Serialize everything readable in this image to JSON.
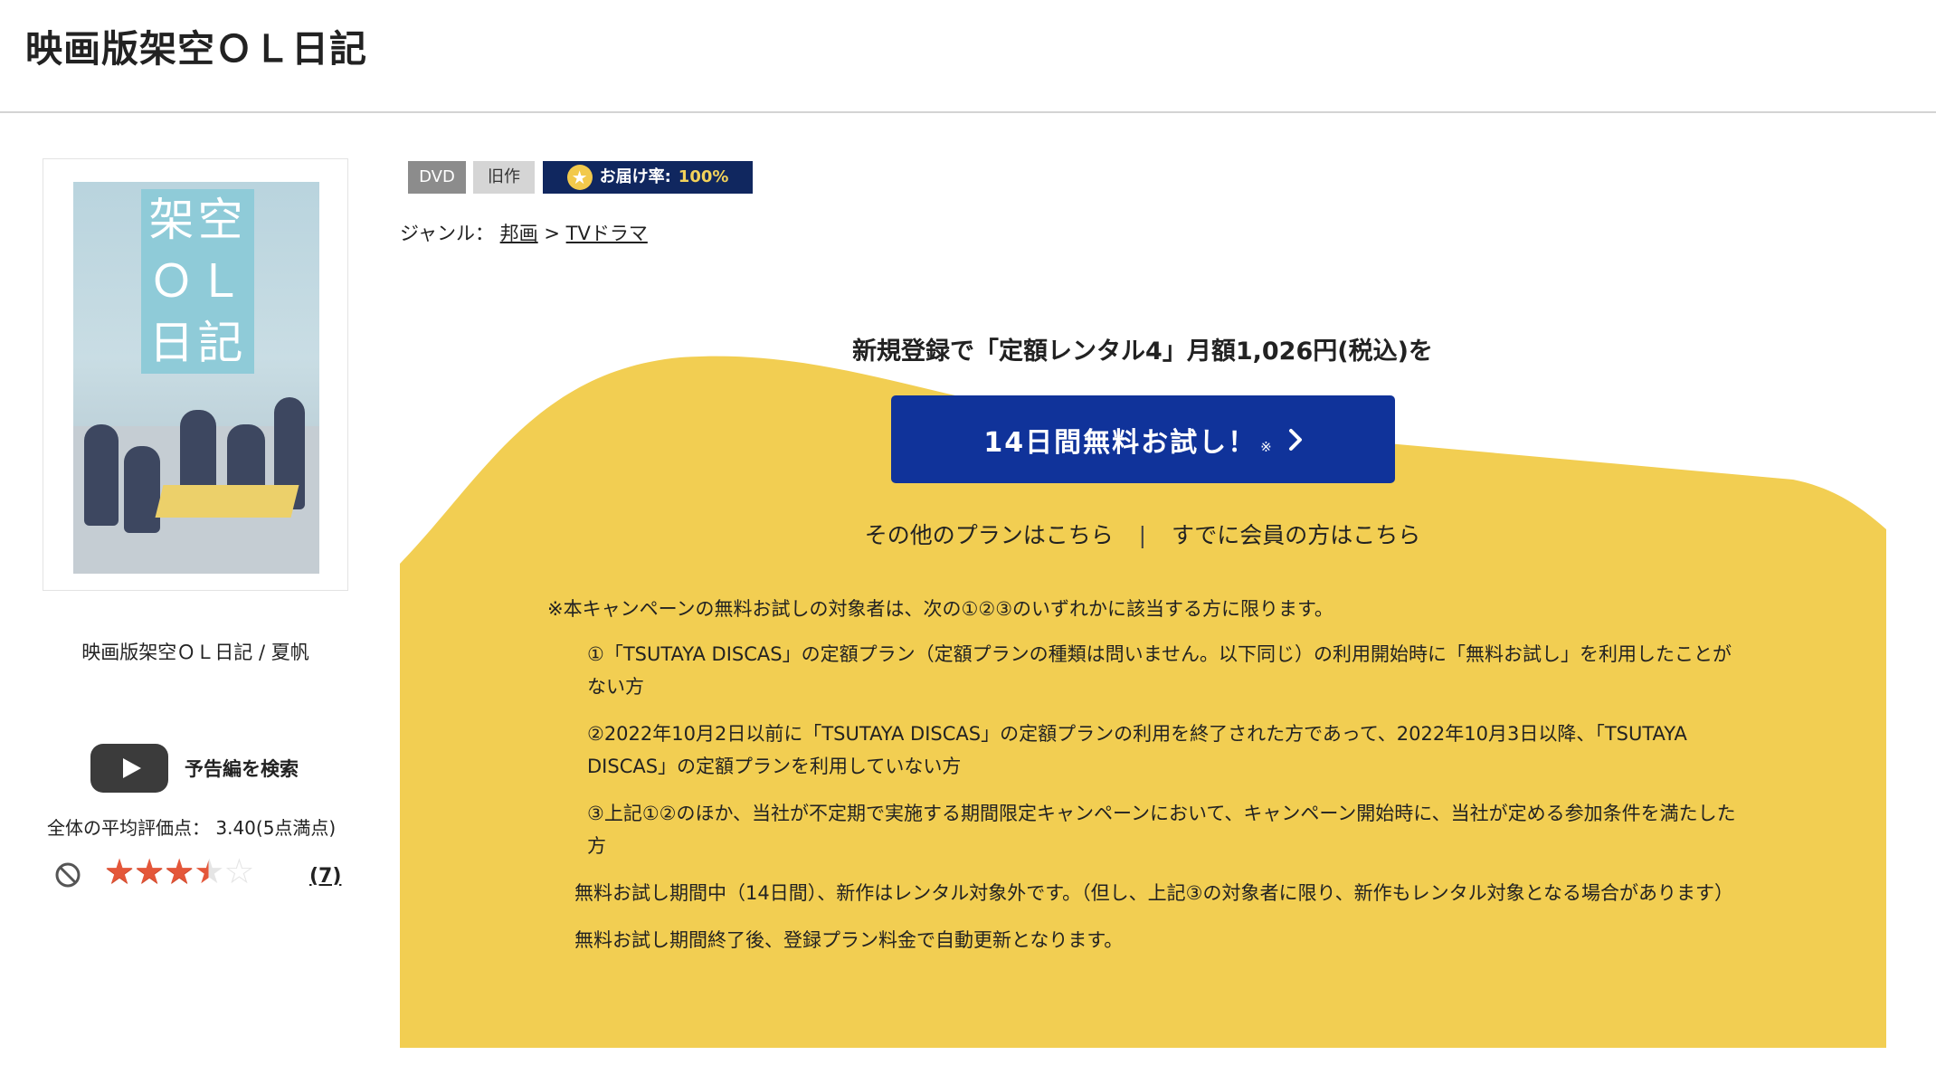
{
  "header": {
    "title": "映画版架空ＯＬ日記"
  },
  "product": {
    "poster_text": [
      "架空",
      "ＯＬ",
      "日記"
    ],
    "caption": "映画版架空ＯＬ日記 / 夏帆",
    "trailer_label": "予告編を検索",
    "rating_text": "全体の平均評価点： 3.40(5点満点)",
    "rating_value": 3.4,
    "rating_max": 5,
    "review_count": "(7)"
  },
  "tags": {
    "format": "DVD",
    "age": "旧作",
    "delivery_label": "お届け率:",
    "delivery_value": "100%"
  },
  "genre": {
    "label": "ジャンル：",
    "level1": "邦画",
    "separator": ">",
    "level2": "TVドラマ"
  },
  "campaign": {
    "headline": "新規登録で「定額レンタル4」月額1,026円(税込)を",
    "button_label": "14日間無料お試し！",
    "button_note": "※",
    "other_plans": "その他のプランはこちら",
    "separator": "|",
    "member_link": "すでに会員の方はこちら",
    "notes": {
      "intro": "※本キャンペーンの無料お試しの対象者は、次の①②③のいずれかに該当する方に限ります。",
      "item1": "①「TSUTAYA DISCAS」の定額プラン（定額プランの種類は問いません。以下同じ）の利用開始時に「無料お試し」を利用したことがない方",
      "item2": "②2022年10月2日以前に「TSUTAYA DISCAS」の定額プランの利用を終了された方であって、2022年10月3日以降、「TSUTAYA DISCAS」の定額プランを利用していない方",
      "item3": "③上記①②のほか、当社が不定期で実施する期間限定キャンペーンにおいて、キャンペーン開始時に、当社が定める参加条件を満たした方",
      "note1": "無料お試し期間中（14日間）、新作はレンタル対象外です。（但し、上記③の対象者に限り、新作もレンタル対象となる場合があります）",
      "note2": "無料お試し期間終了後、登録プラン料金で自動更新となります。"
    }
  },
  "colors": {
    "campaign_yellow": "#f2ce52",
    "button_blue": "#10339a",
    "delivery_navy": "#10275f",
    "star_red": "#e4573a"
  }
}
